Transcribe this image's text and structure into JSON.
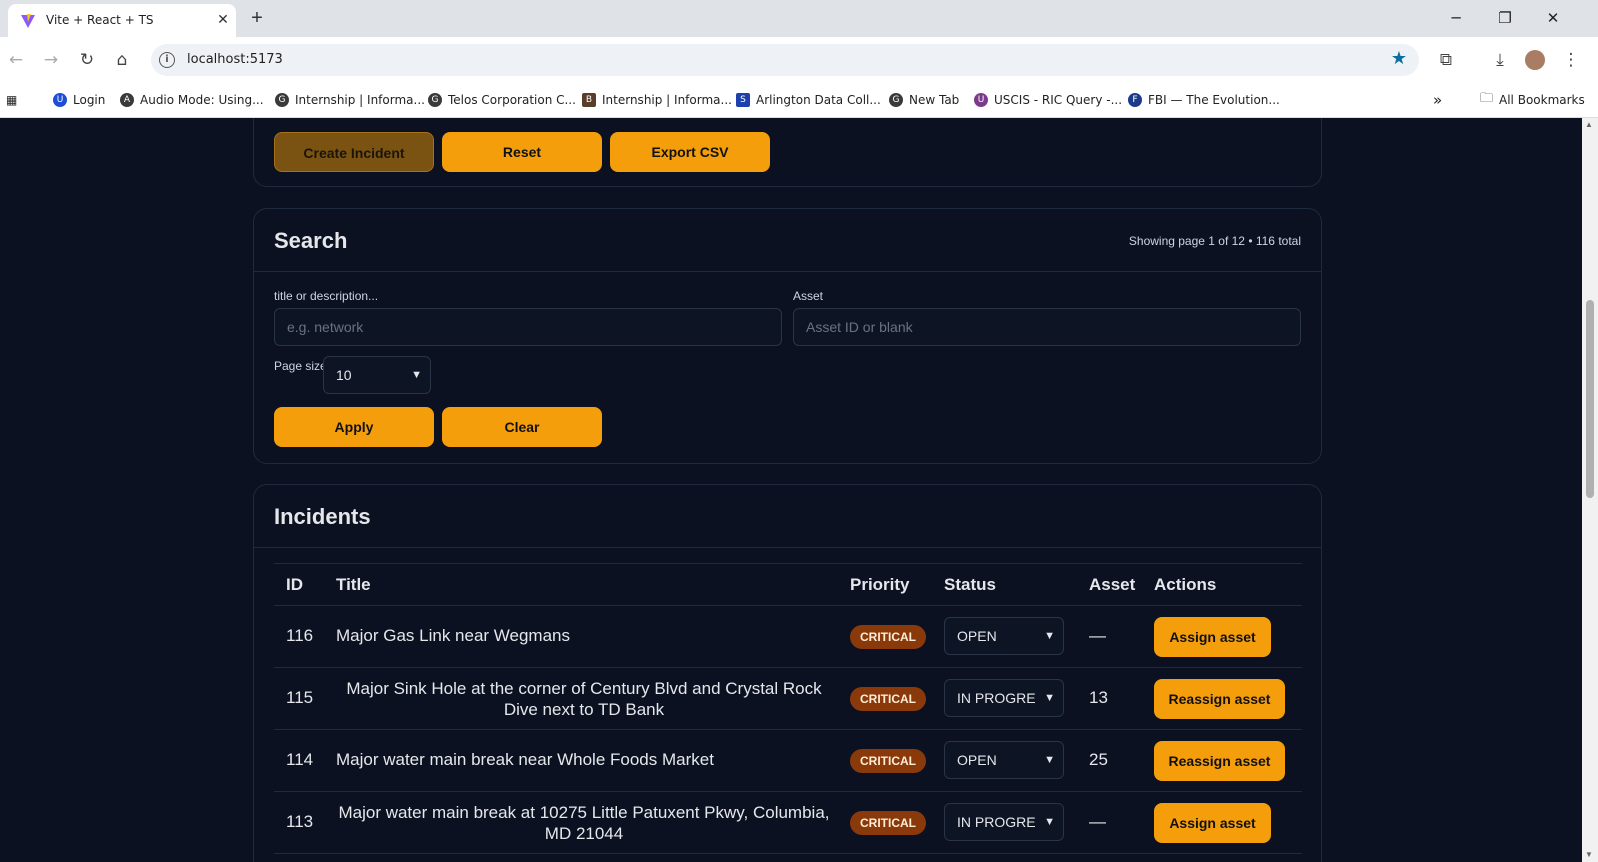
{
  "browser": {
    "tab_title": "Vite + React + TS",
    "tab_close": "✕",
    "new_tab": "+",
    "url": "localhost:5173",
    "window_controls": {
      "minimize": "─",
      "restore": "❐",
      "close": "✕"
    },
    "bookmarks": [
      {
        "label": "Login",
        "icon": "U"
      },
      {
        "label": "Audio Mode: Using...",
        "icon": "A"
      },
      {
        "label": "Internship | Informa...",
        "icon": "G"
      },
      {
        "label": "Telos Corporation C...",
        "icon": "G"
      },
      {
        "label": "Internship | Informa...",
        "icon": "B"
      },
      {
        "label": "Arlington Data Coll...",
        "icon": "S"
      },
      {
        "label": "New Tab",
        "icon": "G"
      },
      {
        "label": "USCIS - RIC Query -...",
        "icon": "U"
      },
      {
        "label": "FBI — The Evolution...",
        "icon": "F"
      }
    ],
    "all_bookmarks": "All Bookmarks",
    "overflow": "»"
  },
  "actions": {
    "create": "Create Incident",
    "reset": "Reset",
    "export": "Export CSV"
  },
  "search": {
    "title": "Search",
    "meta": "Showing page 1 of 12 • 116 total",
    "text_label": "title or description...",
    "text_placeholder": "e.g. network",
    "asset_label": "Asset",
    "asset_placeholder": "Asset ID or blank",
    "page_size_label": "Page size",
    "page_size_value": "10",
    "apply": "Apply",
    "clear": "Clear"
  },
  "incidents": {
    "title": "Incidents",
    "columns": [
      "ID",
      "Title",
      "Priority",
      "Status",
      "Asset",
      "Actions"
    ],
    "rows": [
      {
        "id": "116",
        "title": "Major Gas Link near Wegmans",
        "priority": "CRITICAL",
        "status": "OPEN",
        "asset": "—",
        "action": "Assign asset"
      },
      {
        "id": "115",
        "title": "Major Sink Hole at the corner of Century Blvd and Crystal Rock Dive next to TD Bank",
        "priority": "CRITICAL",
        "status": "IN PROGRE",
        "asset": "13",
        "action": "Reassign asset"
      },
      {
        "id": "114",
        "title": "Major water main break near Whole Foods Market",
        "priority": "CRITICAL",
        "status": "OPEN",
        "asset": "25",
        "action": "Reassign asset"
      },
      {
        "id": "113",
        "title": "Major water main break at 10275 Little Patuxent Pkwy, Columbia, MD 21044",
        "priority": "CRITICAL",
        "status": "IN PROGRE",
        "asset": "—",
        "action": "Assign asset"
      }
    ]
  },
  "colors": {
    "page_bg": "#0b1120",
    "accent": "#f59e0b",
    "badge_critical": "#8a3a0a"
  }
}
